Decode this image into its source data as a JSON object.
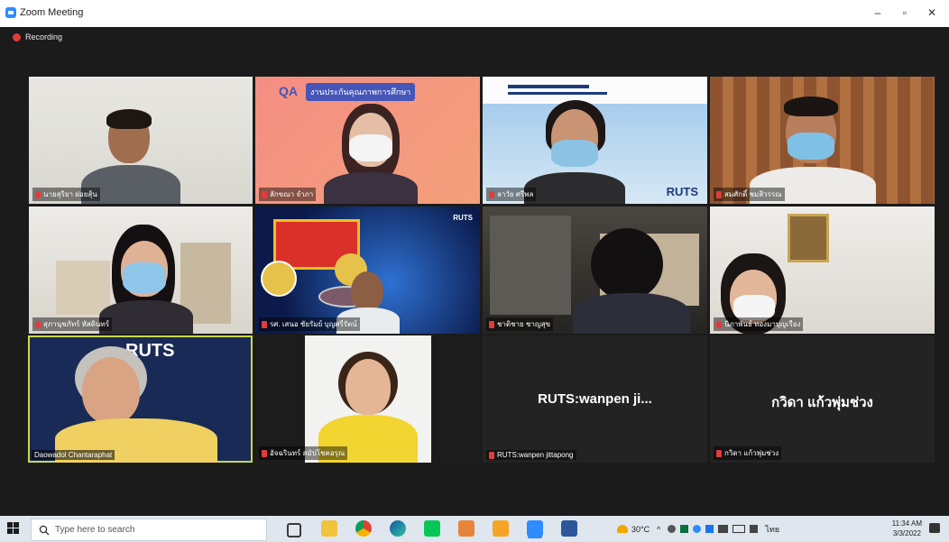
{
  "window": {
    "title": "Zoom Meeting",
    "minimize": "–",
    "restore": "▫",
    "close": "✕"
  },
  "recording": {
    "label": "Recording"
  },
  "tiles": [
    {
      "name": "นายสุริยา  ฝอยสุ้น"
    },
    {
      "name": "ลักขณา  จำภา",
      "banner": "งานประกันคุณภาพการศึกษา",
      "qa": "QA"
    },
    {
      "name": "ลาวัย  ศรีพล",
      "brand": "RUTS"
    },
    {
      "name": "สมศักดิ์ ชมสิวรรณ"
    },
    {
      "name": "สุภานุชภัทร์ หัสดินทร์"
    },
    {
      "name": "รศ. เสนอ  ชัยรัมย์ บุญศรีรัตน์",
      "brand": "RUTS"
    },
    {
      "name": "ชาติชาย ชาญสุข"
    },
    {
      "name": "นิภาพันธ์ ทองมาบุญเรือง"
    },
    {
      "name": "Daowadol Chantaraphat",
      "brand": "RUTS"
    },
    {
      "name": "อัจฉรินทร์ สมัปโชคอรุณ"
    },
    {
      "name": "RUTS:wanpen  jittapong",
      "display": "RUTS:wanpen   ji..."
    },
    {
      "name": "กวิดา แก้วพุ่มช่วง",
      "display": "กวิดา แก้วพุ่มช่วง"
    }
  ],
  "taskbar": {
    "search_placeholder": "Type here to search",
    "weather": "30°C",
    "lang": "ไทย",
    "time": "11:34 AM",
    "date": "3/3/2022"
  },
  "colors": {
    "accent": "#2d8cff",
    "active_speaker": "#c9d94a",
    "mic_muted": "#e23b3b"
  }
}
